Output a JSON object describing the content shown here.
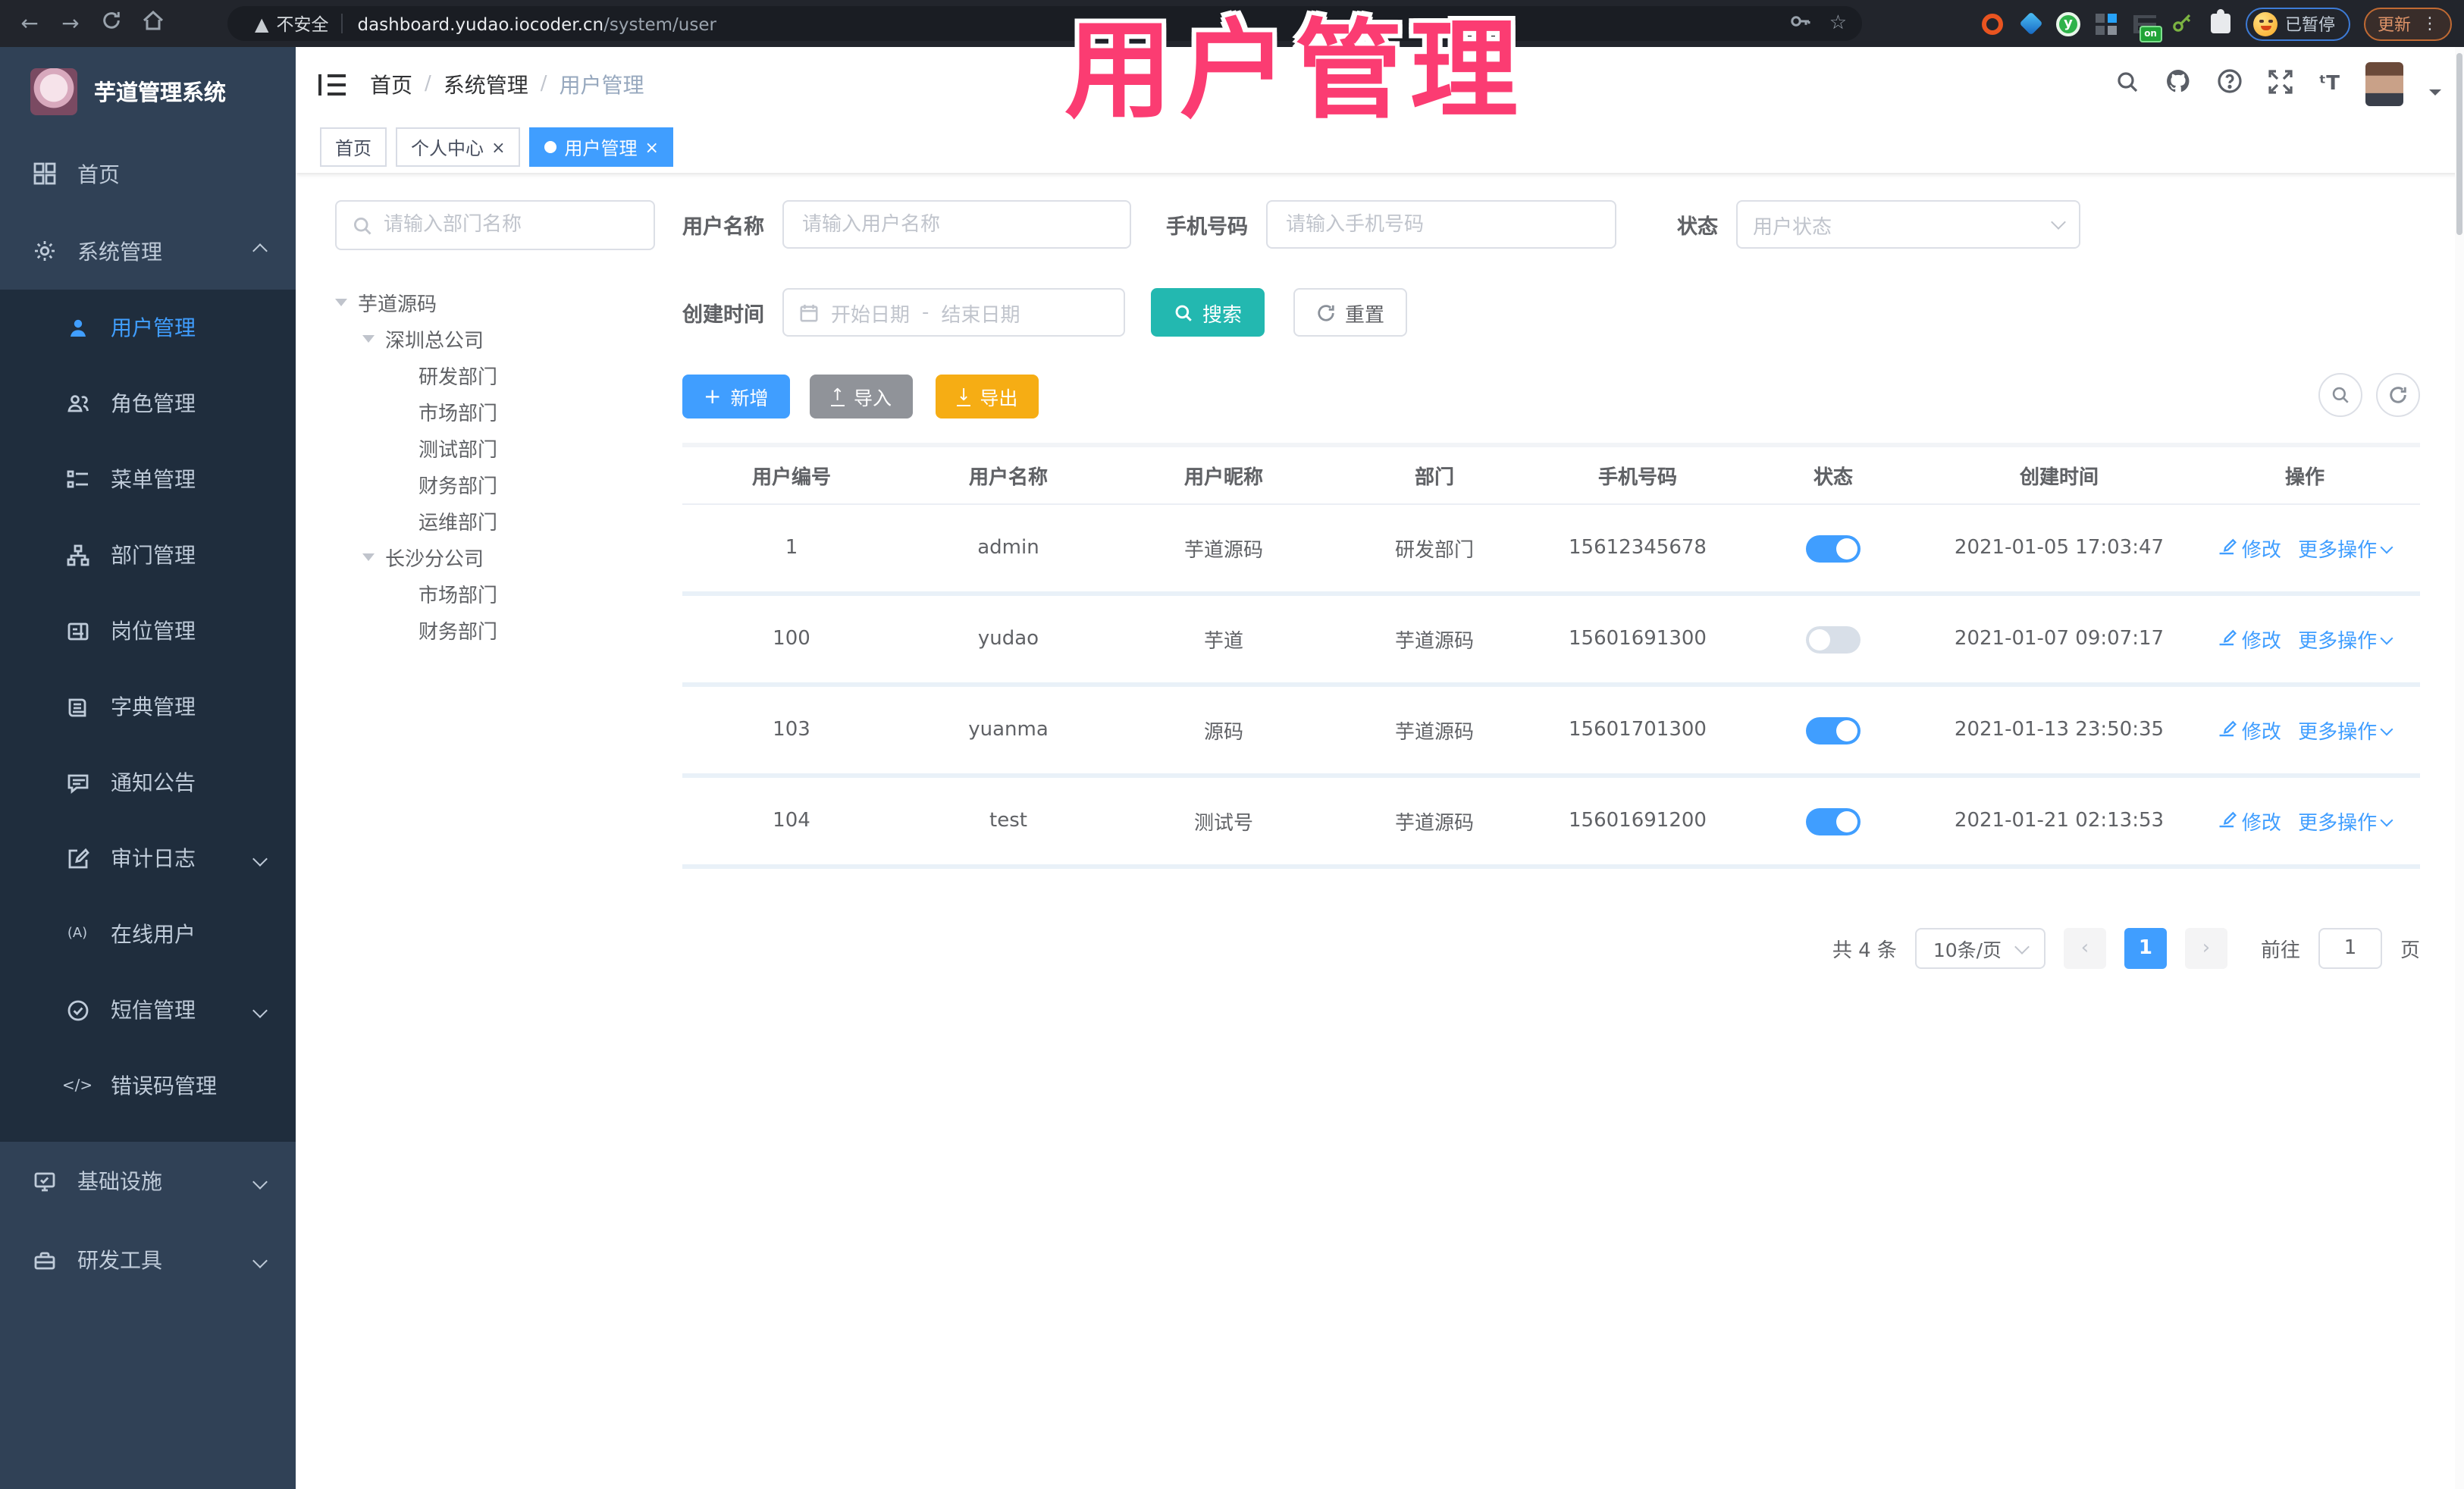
{
  "browser": {
    "security": "不安全",
    "url_host": "dashboard.yudao.iocoder.cn",
    "url_path": "/system/user",
    "paused_badge": "已暂停",
    "update_button": "更新"
  },
  "overlay": {
    "title": "用户管理"
  },
  "app": {
    "logo_title": "芋道管理系统"
  },
  "sidebar": {
    "items": [
      {
        "label": "首页"
      },
      {
        "label": "系统管理"
      },
      {
        "label": "用户管理"
      },
      {
        "label": "角色管理"
      },
      {
        "label": "菜单管理"
      },
      {
        "label": "部门管理"
      },
      {
        "label": "岗位管理"
      },
      {
        "label": "字典管理"
      },
      {
        "label": "通知公告"
      },
      {
        "label": "审计日志"
      },
      {
        "label": "在线用户"
      },
      {
        "label": "短信管理"
      },
      {
        "label": "错误码管理"
      },
      {
        "label": "基础设施"
      },
      {
        "label": "研发工具"
      }
    ]
  },
  "breadcrumb": {
    "items": [
      "首页",
      "系统管理",
      "用户管理"
    ]
  },
  "tabs": [
    {
      "label": "首页"
    },
    {
      "label": "个人中心"
    },
    {
      "label": "用户管理"
    }
  ],
  "dept": {
    "search_placeholder": "请输入部门名称",
    "nodes": [
      "芋道源码",
      "深圳总公司",
      "研发部门",
      "市场部门",
      "测试部门",
      "财务部门",
      "运维部门",
      "长沙分公司",
      "市场部门",
      "财务部门"
    ]
  },
  "filters": {
    "username_label": "用户名称",
    "username_placeholder": "请输入用户名称",
    "mobile_label": "手机号码",
    "mobile_placeholder": "请输入手机号码",
    "status_label": "状态",
    "status_placeholder": "用户状态",
    "create_time_label": "创建时间",
    "start_placeholder": "开始日期",
    "range_separator": "-",
    "end_placeholder": "结束日期",
    "search_button": "搜索",
    "reset_button": "重置"
  },
  "toolbar": {
    "add": "新增",
    "import": "导入",
    "export": "导出"
  },
  "table": {
    "columns": [
      "用户编号",
      "用户名称",
      "用户昵称",
      "部门",
      "手机号码",
      "状态",
      "创建时间",
      "操作"
    ],
    "edit_label": "修改",
    "more_label": "更多操作",
    "rows": [
      {
        "id": "1",
        "username": "admin",
        "nickname": "芋道源码",
        "dept": "研发部门",
        "mobile": "15612345678",
        "status": "on",
        "created": "2021-01-05 17:03:47"
      },
      {
        "id": "100",
        "username": "yudao",
        "nickname": "芋道",
        "dept": "芋道源码",
        "mobile": "15601691300",
        "status": "off",
        "created": "2021-01-07 09:07:17"
      },
      {
        "id": "103",
        "username": "yuanma",
        "nickname": "源码",
        "dept": "芋道源码",
        "mobile": "15601701300",
        "status": "on",
        "created": "2021-01-13 23:50:35"
      },
      {
        "id": "104",
        "username": "test",
        "nickname": "测试号",
        "dept": "芋道源码",
        "mobile": "15601691200",
        "status": "on",
        "created": "2021-01-21 02:13:53"
      }
    ]
  },
  "pagination": {
    "total": "共 4 条",
    "page_size": "10条/页",
    "current_page": "1",
    "goto_label": "前往",
    "goto_value": "1",
    "page_unit": "页"
  },
  "colors": {
    "accent": "#409eff",
    "teal": "#23b8b0",
    "warning": "#f6ad14",
    "sidebar": "#304156",
    "overlay_pink": "#fb3c72"
  }
}
